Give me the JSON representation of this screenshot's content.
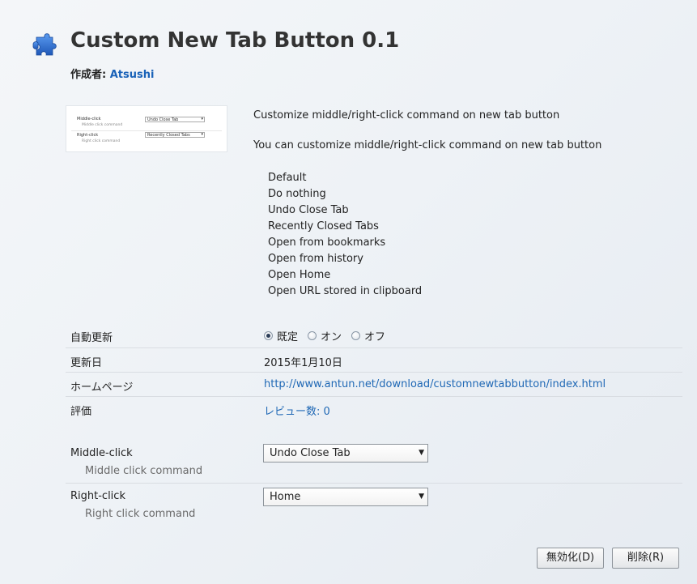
{
  "header": {
    "title": "Custom New Tab Button 0.1",
    "author_label": "作成者:",
    "author_name": "Atsushi"
  },
  "thumbnail": {
    "row1_label": "Middle-click",
    "row1_sub": "Middle click command",
    "row1_value": "Undo Close Tab",
    "row2_label": "Right-click",
    "row2_sub": "Right click command",
    "row2_value": "Recently Closed Tabs"
  },
  "description": {
    "summary": "Customize middle/right-click command on new tab button",
    "intro": "You can customize middle/right-click command on new tab button",
    "options": [
      "Default",
      "Do nothing",
      "Undo Close Tab",
      "Recently Closed Tabs",
      "Open from bookmarks",
      "Open from history",
      "Open Home",
      "Open URL stored in clipboard"
    ]
  },
  "details": {
    "auto_update_label": "自動更新",
    "auto_update_options": [
      "既定",
      "オン",
      "オフ"
    ],
    "auto_update_selected": "既定",
    "updated_label": "更新日",
    "updated_value": "2015年1月10日",
    "homepage_label": "ホームページ",
    "homepage_url": "http://www.antun.net/download/customnewtabbutton/index.html",
    "rating_label": "評価",
    "rating_value": "レビュー数: 0"
  },
  "preferences": {
    "middle_label": "Middle-click",
    "middle_sub": "Middle click command",
    "middle_value": "Undo Close Tab",
    "right_label": "Right-click",
    "right_sub": "Right click command",
    "right_value": "Home"
  },
  "buttons": {
    "disable_label": "無効化(D)",
    "remove_label": "削除(R)"
  },
  "icons": {
    "addon": "puzzle-piece-icon",
    "dropdown": "chevron-down-icon"
  },
  "colors": {
    "link": "#1f68b5",
    "icon": "#2f6fce"
  }
}
